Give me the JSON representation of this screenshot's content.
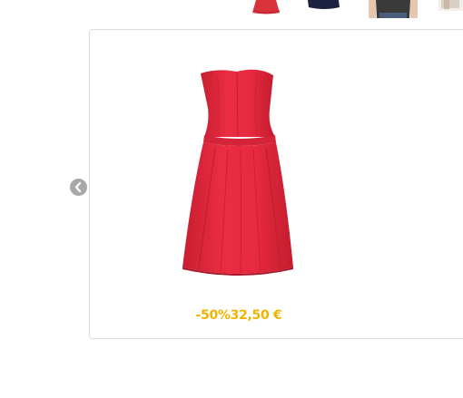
{
  "thumbnails": [
    {
      "name": "red-dress-thumbnail",
      "color": "#d9323a"
    },
    {
      "name": "navy-dress-thumbnail",
      "color": "#1c2340"
    },
    {
      "name": "grey-top-thumbnail",
      "color": "#3a3a3a"
    },
    {
      "name": "beige-item-thumbnail",
      "color": "#d9cfc4"
    }
  ],
  "carousel": {
    "prev_icon": "chevron-left-icon"
  },
  "product": {
    "image_icon": "red-strapless-dress",
    "dress_color": "#e8283e",
    "discount": "-50%",
    "price": "32,50 €",
    "price_color": "#f0b400"
  }
}
